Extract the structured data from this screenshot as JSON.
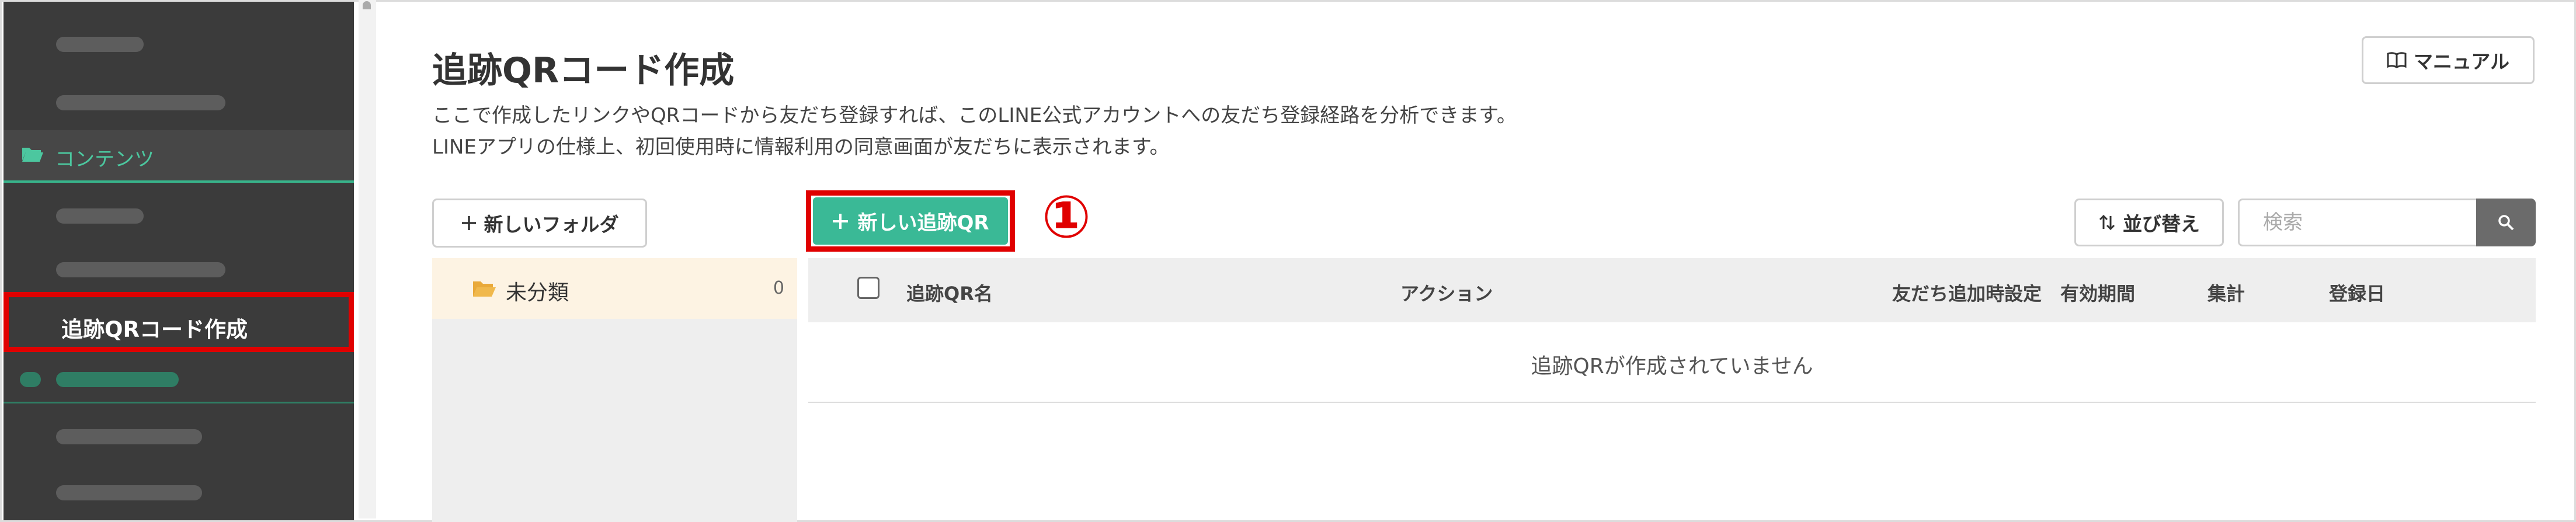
{
  "sidebar": {
    "active_section": "コンテンツ",
    "selected_item": "追跡QRコード作成"
  },
  "page": {
    "title": "追跡QRコード作成",
    "description_line1": "ここで作成したリンクやQRコードから友だち登録すれば、このLINE公式アカウントへの友だち登録経路を分析できます。",
    "description_line2": "LINEアプリの仕様上、初回使用時に情報利用の同意画面が友だちに表示されます。"
  },
  "toolbar": {
    "manual_label": "マニュアル",
    "new_folder_label": "新しいフォルダ",
    "new_qr_label": "新しい追跡QR",
    "callout": "①",
    "sort_label": "並び替え",
    "search_placeholder": "検索"
  },
  "folders": [
    {
      "name": "未分類",
      "count": "0"
    }
  ],
  "table": {
    "columns": [
      "追跡QR名",
      "アクション",
      "友だち追加時設定",
      "有効期間",
      "集計",
      "登録日"
    ],
    "empty_message": "追跡QRが作成されていません"
  },
  "colors": {
    "accent_green": "#3ab996",
    "highlight_red": "#e00000",
    "sidebar_bg": "#3b3b3b",
    "folder_row_bg": "#fdf3e3"
  }
}
